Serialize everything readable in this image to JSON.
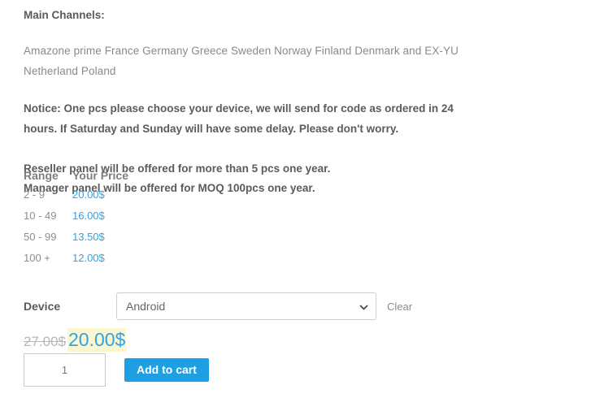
{
  "content": {
    "main_channels_heading": "Main Channels:",
    "channels_text": "Amazone prime France Germany Greece Sweden Norway Finland Denmark and EX-YU Netherland Poland",
    "notice_text": "Notice: One pcs please choose your device, we will send for code as ordered in 24 hours. If Saturday and Sunday will have some delay. Please don't worry.",
    "reseller_line": "Reseller panel will be offered for more than 5 pcs one year.",
    "manager_line": "Manager panel will be offered for MOQ 100pcs one year."
  },
  "price_table": {
    "headers": {
      "range": "Range",
      "price": "Your Price"
    },
    "rows": [
      {
        "range": "2 - 9",
        "price": "20.00$"
      },
      {
        "range": "10 - 49",
        "price": "16.00$"
      },
      {
        "range": "50 - 99",
        "price": "13.50$"
      },
      {
        "range": "100 +",
        "price": "12.00$"
      }
    ]
  },
  "device": {
    "label": "Device",
    "selected": "Android",
    "options": [
      "Android"
    ],
    "clear_label": "Clear",
    "chevron_icon": "chevron-down-icon"
  },
  "price_display": {
    "old_price": "27.00$",
    "new_price": "20.00$"
  },
  "cart": {
    "quantity": "1",
    "add_to_cart_label": "Add to cart"
  },
  "colors": {
    "accent_blue": "#2ea3e9",
    "button_blue": "#1e9fe3",
    "highlight_yellow": "#fbf6cf",
    "text_dark": "#5b5b5b",
    "text_muted": "#8a8a8a",
    "old_price_gray": "#b7b7b7"
  }
}
